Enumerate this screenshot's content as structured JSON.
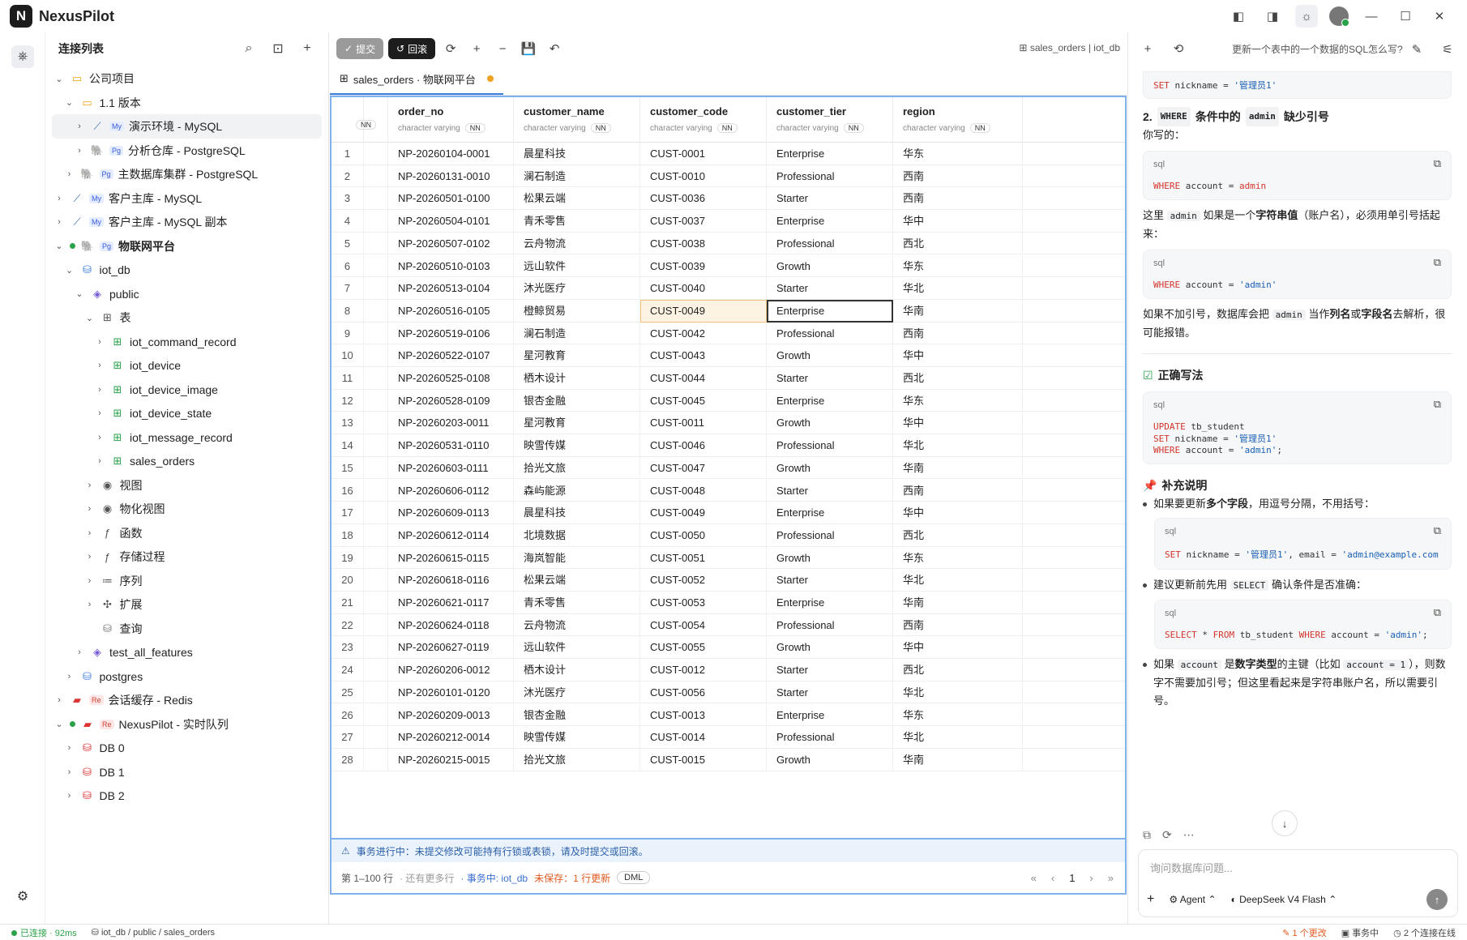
{
  "app": {
    "name": "NexusPilot",
    "logo": "N"
  },
  "sidebar": {
    "title": "连接列表",
    "tree": [
      {
        "label": "公司项目",
        "depth": 0,
        "chev": "down",
        "icon": "folder-icon",
        "glyph": "▭",
        "color": "#e8a317"
      },
      {
        "label": "1.1 版本",
        "depth": 1,
        "chev": "down",
        "icon": "folder-icon",
        "glyph": "▭",
        "color": "#e8a317"
      },
      {
        "label": "演示环境 - MySQL",
        "depth": 2,
        "chev": "right",
        "icon": "mysql-icon",
        "glyph": "⟋",
        "color": "#3a6fb0",
        "badge": "My",
        "selected": true
      },
      {
        "label": "分析仓库 - PostgreSQL",
        "depth": 2,
        "chev": "right",
        "icon": "postgres-icon",
        "glyph": "🐘",
        "color": "#336791",
        "badge": "Pg"
      },
      {
        "label": "主数据库集群 - PostgreSQL",
        "depth": 1,
        "chev": "right",
        "icon": "postgres-icon",
        "glyph": "🐘",
        "color": "#336791",
        "badge": "Pg"
      },
      {
        "label": "客户主库 - MySQL",
        "depth": 0,
        "chev": "right",
        "icon": "mysql-icon",
        "glyph": "⟋",
        "color": "#3a6fb0",
        "badge": "My"
      },
      {
        "label": "客户主库 - MySQL 副本",
        "depth": 0,
        "chev": "right",
        "icon": "mysql-icon",
        "glyph": "⟋",
        "color": "#3a6fb0",
        "badge": "My"
      },
      {
        "label": "物联网平台",
        "depth": 0,
        "chev": "down",
        "icon": "postgres-icon",
        "glyph": "🐘",
        "color": "#336791",
        "badge": "Pg",
        "online": true,
        "bold": true
      },
      {
        "label": "iot_db",
        "depth": 1,
        "chev": "down",
        "icon": "database-icon",
        "glyph": "⛁",
        "color": "#3b7ddd"
      },
      {
        "label": "public",
        "depth": 2,
        "chev": "down",
        "icon": "schema-icon",
        "glyph": "◈",
        "color": "#7b5cd6"
      },
      {
        "label": "表",
        "depth": 3,
        "chev": "down",
        "icon": "table-group-icon",
        "glyph": "⊞",
        "color": "#555"
      },
      {
        "label": "iot_command_record",
        "depth": 4,
        "chev": "right",
        "icon": "table-icon",
        "glyph": "⊞",
        "color": "#2aa24a"
      },
      {
        "label": "iot_device",
        "depth": 4,
        "chev": "right",
        "icon": "table-icon",
        "glyph": "⊞",
        "color": "#2aa24a"
      },
      {
        "label": "iot_device_image",
        "depth": 4,
        "chev": "right",
        "icon": "table-icon",
        "glyph": "⊞",
        "color": "#2aa24a"
      },
      {
        "label": "iot_device_state",
        "depth": 4,
        "chev": "right",
        "icon": "table-icon",
        "glyph": "⊞",
        "color": "#2aa24a"
      },
      {
        "label": "iot_message_record",
        "depth": 4,
        "chev": "right",
        "icon": "table-icon",
        "glyph": "⊞",
        "color": "#2aa24a"
      },
      {
        "label": "sales_orders",
        "depth": 4,
        "chev": "right",
        "icon": "table-icon",
        "glyph": "⊞",
        "color": "#2aa24a"
      },
      {
        "label": "视图",
        "depth": 3,
        "chev": "right",
        "icon": "view-icon",
        "glyph": "◉",
        "color": "#555"
      },
      {
        "label": "物化视图",
        "depth": 3,
        "chev": "right",
        "icon": "materialized-view-icon",
        "glyph": "◉",
        "color": "#555"
      },
      {
        "label": "函数",
        "depth": 3,
        "chev": "right",
        "icon": "function-icon",
        "glyph": "ƒ",
        "color": "#555"
      },
      {
        "label": "存储过程",
        "depth": 3,
        "chev": "right",
        "icon": "procedure-icon",
        "glyph": "ƒ",
        "color": "#555"
      },
      {
        "label": "序列",
        "depth": 3,
        "chev": "right",
        "icon": "sequence-icon",
        "glyph": "≔",
        "color": "#555"
      },
      {
        "label": "扩展",
        "depth": 3,
        "chev": "right",
        "icon": "extension-icon",
        "glyph": "✣",
        "color": "#555"
      },
      {
        "label": "查询",
        "depth": 3,
        "chev": "",
        "icon": "query-icon",
        "glyph": "⛁",
        "color": "#777"
      },
      {
        "label": "test_all_features",
        "depth": 2,
        "chev": "right",
        "icon": "schema-icon",
        "glyph": "◈",
        "color": "#7b5cd6"
      },
      {
        "label": "postgres",
        "depth": 1,
        "chev": "right",
        "icon": "database-icon",
        "glyph": "⛁",
        "color": "#3b7ddd"
      },
      {
        "label": "会话缓存 - Redis",
        "depth": 0,
        "chev": "right",
        "icon": "redis-icon",
        "glyph": "▰",
        "color": "#d33",
        "badge": "Re",
        "badgeClass": "re"
      },
      {
        "label": "NexusPilot - 实时队列",
        "depth": 0,
        "chev": "down",
        "icon": "redis-icon",
        "glyph": "▰",
        "color": "#d33",
        "badge": "Re",
        "badgeClass": "re",
        "online": true
      },
      {
        "label": "DB 0",
        "depth": 1,
        "chev": "right",
        "icon": "database-icon",
        "glyph": "⛁",
        "color": "#d33"
      },
      {
        "label": "DB 1",
        "depth": 1,
        "chev": "right",
        "icon": "database-icon",
        "glyph": "⛁",
        "color": "#d33"
      },
      {
        "label": "DB 2",
        "depth": 1,
        "chev": "right",
        "icon": "database-icon",
        "glyph": "⛁",
        "color": "#d33"
      }
    ]
  },
  "toolbar": {
    "commit": "提交",
    "rollback": "回滚",
    "context": "sales_orders | iot_db"
  },
  "tab": {
    "label": "sales_orders · 物联网平台"
  },
  "grid": {
    "columns": [
      {
        "name": "order_no",
        "type": "character varying",
        "nn": "NN"
      },
      {
        "name": "customer_name",
        "type": "character varying",
        "nn": "NN"
      },
      {
        "name": "customer_code",
        "type": "character varying",
        "nn": "NN"
      },
      {
        "name": "customer_tier",
        "type": "character varying",
        "nn": "NN"
      },
      {
        "name": "region",
        "type": "character varying",
        "nn": "NN"
      }
    ],
    "prev_nn": "NN",
    "rows": [
      [
        "1",
        "NP-20260104-0001",
        "晨星科技",
        "CUST-0001",
        "Enterprise",
        "华东"
      ],
      [
        "2",
        "NP-20260131-0010",
        "澜石制造",
        "CUST-0010",
        "Professional",
        "西南"
      ],
      [
        "3",
        "NP-20260501-0100",
        "松果云端",
        "CUST-0036",
        "Starter",
        "西南"
      ],
      [
        "4",
        "NP-20260504-0101",
        "青禾零售",
        "CUST-0037",
        "Enterprise",
        "华中"
      ],
      [
        "5",
        "NP-20260507-0102",
        "云舟物流",
        "CUST-0038",
        "Professional",
        "西北"
      ],
      [
        "6",
        "NP-20260510-0103",
        "远山软件",
        "CUST-0039",
        "Growth",
        "华东"
      ],
      [
        "7",
        "NP-20260513-0104",
        "沐光医疗",
        "CUST-0040",
        "Starter",
        "华北"
      ],
      [
        "8",
        "NP-20260516-0105",
        "橙鲸贸易",
        "CUST-0049",
        "Enterprise",
        "华南"
      ],
      [
        "9",
        "NP-20260519-0106",
        "澜石制造",
        "CUST-0042",
        "Professional",
        "西南"
      ],
      [
        "10",
        "NP-20260522-0107",
        "星河教育",
        "CUST-0043",
        "Growth",
        "华中"
      ],
      [
        "11",
        "NP-20260525-0108",
        "栖木设计",
        "CUST-0044",
        "Starter",
        "西北"
      ],
      [
        "12",
        "NP-20260528-0109",
        "银杏金融",
        "CUST-0045",
        "Enterprise",
        "华东"
      ],
      [
        "13",
        "NP-20260203-0011",
        "星河教育",
        "CUST-0011",
        "Growth",
        "华中"
      ],
      [
        "14",
        "NP-20260531-0110",
        "映雪传媒",
        "CUST-0046",
        "Professional",
        "华北"
      ],
      [
        "15",
        "NP-20260603-0111",
        "拾光文旅",
        "CUST-0047",
        "Growth",
        "华南"
      ],
      [
        "16",
        "NP-20260606-0112",
        "森屿能源",
        "CUST-0048",
        "Starter",
        "西南"
      ],
      [
        "17",
        "NP-20260609-0113",
        "晨星科技",
        "CUST-0049",
        "Enterprise",
        "华中"
      ],
      [
        "18",
        "NP-20260612-0114",
        "北境数据",
        "CUST-0050",
        "Professional",
        "西北"
      ],
      [
        "19",
        "NP-20260615-0115",
        "海岚智能",
        "CUST-0051",
        "Growth",
        "华东"
      ],
      [
        "20",
        "NP-20260618-0116",
        "松果云端",
        "CUST-0052",
        "Starter",
        "华北"
      ],
      [
        "21",
        "NP-20260621-0117",
        "青禾零售",
        "CUST-0053",
        "Enterprise",
        "华南"
      ],
      [
        "22",
        "NP-20260624-0118",
        "云舟物流",
        "CUST-0054",
        "Professional",
        "西南"
      ],
      [
        "23",
        "NP-20260627-0119",
        "远山软件",
        "CUST-0055",
        "Growth",
        "华中"
      ],
      [
        "24",
        "NP-20260206-0012",
        "栖木设计",
        "CUST-0012",
        "Starter",
        "西北"
      ],
      [
        "25",
        "NP-20260101-0120",
        "沐光医疗",
        "CUST-0056",
        "Starter",
        "华北"
      ],
      [
        "26",
        "NP-20260209-0013",
        "银杏金融",
        "CUST-0013",
        "Enterprise",
        "华东"
      ],
      [
        "27",
        "NP-20260212-0014",
        "映雪传媒",
        "CUST-0014",
        "Professional",
        "华北"
      ],
      [
        "28",
        "NP-20260215-0015",
        "拾光文旅",
        "CUST-0015",
        "Growth",
        "华南"
      ]
    ]
  },
  "txbar": {
    "text": "事务进行中：未提交修改可能持有行锁或表锁，请及时提交或回滚。"
  },
  "status": {
    "range": "第 1–100 行",
    "more": "· 还有更多行",
    "tx_label": "· 事务中:",
    "tx_db": "iot_db",
    "unsaved": "未保存：1 行更新",
    "dml": "DML",
    "page": "1"
  },
  "chat": {
    "question": "更新一个表中的一个数据的SQL怎么写?",
    "input_placeholder": "询问数据库问题...",
    "agent": "Agent",
    "model": "DeepSeek V4 Flash"
  },
  "footer": {
    "connected": "已连接 · 92ms",
    "path": "iot_db / public / sales_orders",
    "changes": "1 个更改",
    "tx": "事务中",
    "online": "2 个连接在线"
  }
}
